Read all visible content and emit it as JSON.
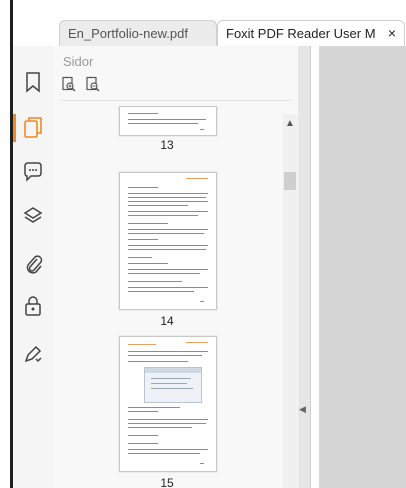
{
  "tabs": [
    {
      "label": "En_Portfolio-new.pdf",
      "active": false
    },
    {
      "label": "Foxit PDF Reader User M...",
      "active": true
    }
  ],
  "tab_close_glyph": "×",
  "rail_icons": [
    "bookmark-icon",
    "pages-icon",
    "comment-icon",
    "layers-icon",
    "attachment-icon",
    "security-icon",
    "signature-icon"
  ],
  "panel": {
    "title": "Sidor",
    "tools": [
      "zoom-in-thumbnail-icon",
      "zoom-out-thumbnail-icon"
    ]
  },
  "pages": [
    {
      "number": "13"
    },
    {
      "number": "14"
    },
    {
      "number": "15"
    }
  ],
  "colors": {
    "accent": "#f08a24",
    "rail_bg": "#f5f5f5",
    "panel_bg": "#f8f8f8"
  }
}
